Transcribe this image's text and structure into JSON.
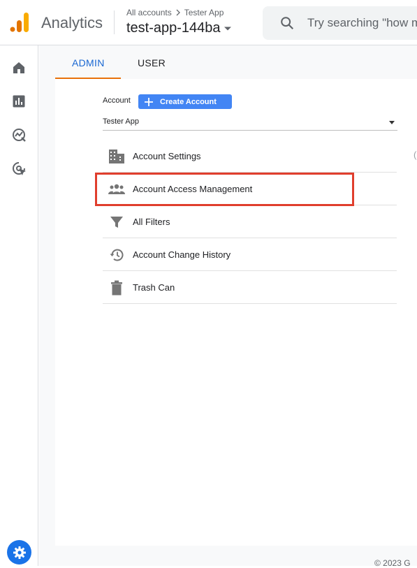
{
  "header": {
    "app_name": "Analytics",
    "breadcrumb_account": "All accounts",
    "breadcrumb_property": "Tester App",
    "property_name": "test-app-144ba",
    "search_placeholder": "Try searching \"how m"
  },
  "leftnav": {
    "items": [
      {
        "icon": "home-icon"
      },
      {
        "icon": "reports-icon"
      },
      {
        "icon": "explore-icon"
      },
      {
        "icon": "advertising-icon"
      }
    ],
    "admin_icon": "gear-icon"
  },
  "tabs": [
    {
      "label": "ADMIN",
      "active": true
    },
    {
      "label": "USER",
      "active": false
    }
  ],
  "account": {
    "label": "Account",
    "create_button": "Create Account",
    "selected": "Tester App"
  },
  "menu": [
    {
      "label": "Account Settings",
      "icon": "building-icon"
    },
    {
      "label": "Account Access Management",
      "icon": "people-icon",
      "highlighted": true
    },
    {
      "label": "All Filters",
      "icon": "filter-icon"
    },
    {
      "label": "Account Change History",
      "icon": "history-icon"
    },
    {
      "label": "Trash Can",
      "icon": "trash-icon"
    }
  ],
  "edge_glyph": "(",
  "footer": "© 2023 G",
  "colors": {
    "accent": "#1a73e8",
    "tab_underline": "#e8710a",
    "highlight": "#e03e2d",
    "create_button": "#4285f4"
  }
}
